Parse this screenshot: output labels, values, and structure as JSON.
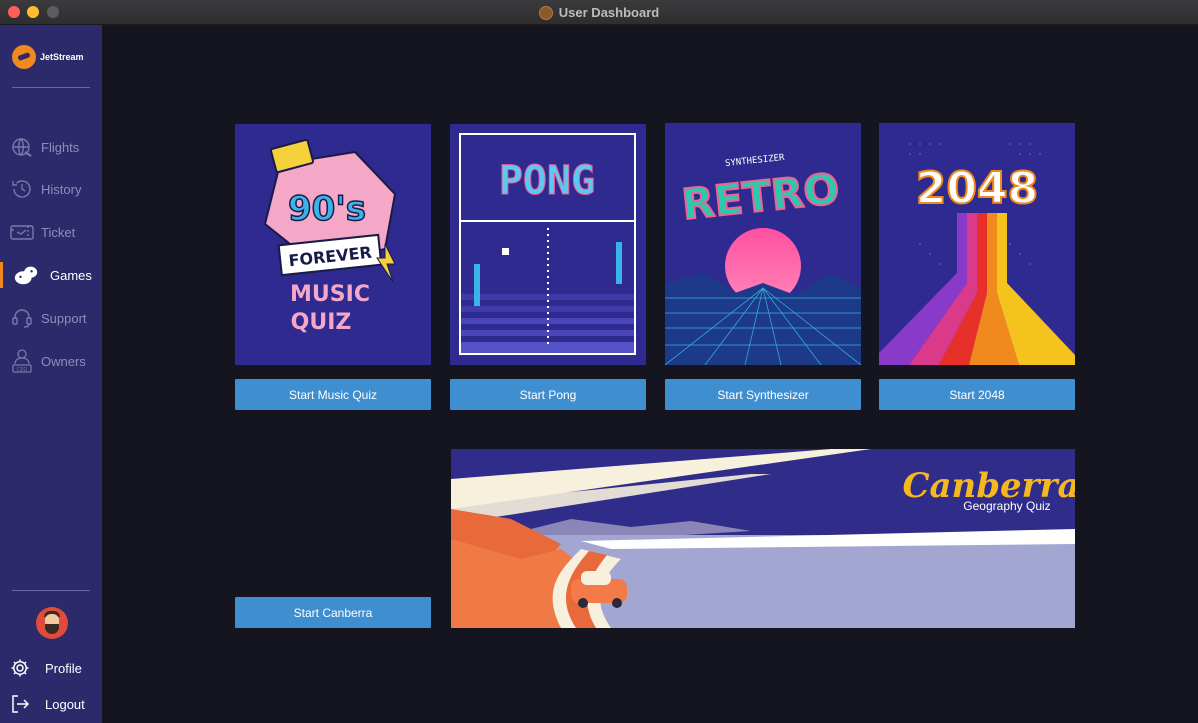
{
  "window": {
    "title": "User Dashboard"
  },
  "brand": {
    "name": "JetStream"
  },
  "nav": [
    {
      "id": "flights",
      "label": "Flights",
      "icon": "globe-plane-icon"
    },
    {
      "id": "history",
      "label": "History",
      "icon": "clock-history-icon"
    },
    {
      "id": "ticket",
      "label": "Ticket",
      "icon": "ticket-icon"
    },
    {
      "id": "games",
      "label": "Games",
      "icon": "gamepad-icon",
      "active": true
    },
    {
      "id": "support",
      "label": "Support",
      "icon": "headset-icon"
    },
    {
      "id": "owners",
      "label": "Owners",
      "icon": "ceo-icon"
    }
  ],
  "account": {
    "profile_label": "Profile",
    "logout_label": "Logout"
  },
  "games": [
    {
      "id": "music-quiz",
      "button": "Start Music Quiz",
      "art": {
        "badge": "90's",
        "ribbon": "FOREVER",
        "line1": "MUSIC",
        "line2": "QUIZ"
      }
    },
    {
      "id": "pong",
      "button": "Start Pong",
      "art": {
        "title": "PONG"
      }
    },
    {
      "id": "synthesizer",
      "button": "Start Synthesizer",
      "art": {
        "sub": "SYNTHESIZER",
        "title": "RETRO"
      }
    },
    {
      "id": "2048",
      "button": "Start 2048",
      "art": {
        "title": "2048"
      }
    }
  ],
  "canberra": {
    "button": "Start Canberra",
    "title": "Canberra",
    "subtitle": "Geography Quiz"
  },
  "colors": {
    "accent": "#f0891f",
    "button": "#3f8ed0",
    "sidebar": "#2c2a6b",
    "background": "#15151f"
  }
}
